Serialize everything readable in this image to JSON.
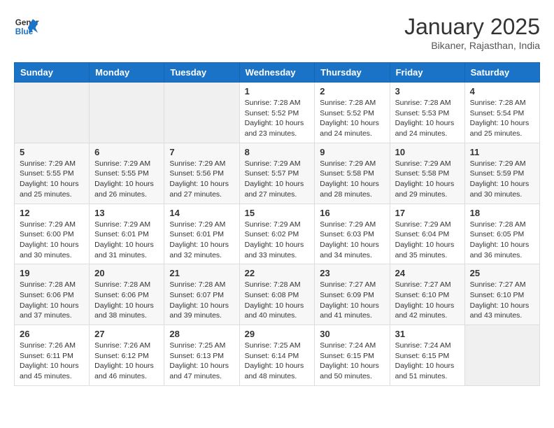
{
  "header": {
    "logo_general": "General",
    "logo_blue": "Blue",
    "month_title": "January 2025",
    "subtitle": "Bikaner, Rajasthan, India"
  },
  "weekdays": [
    "Sunday",
    "Monday",
    "Tuesday",
    "Wednesday",
    "Thursday",
    "Friday",
    "Saturday"
  ],
  "weeks": [
    [
      {
        "day": "",
        "info": ""
      },
      {
        "day": "",
        "info": ""
      },
      {
        "day": "",
        "info": ""
      },
      {
        "day": "1",
        "info": "Sunrise: 7:28 AM\nSunset: 5:52 PM\nDaylight: 10 hours\nand 23 minutes."
      },
      {
        "day": "2",
        "info": "Sunrise: 7:28 AM\nSunset: 5:52 PM\nDaylight: 10 hours\nand 24 minutes."
      },
      {
        "day": "3",
        "info": "Sunrise: 7:28 AM\nSunset: 5:53 PM\nDaylight: 10 hours\nand 24 minutes."
      },
      {
        "day": "4",
        "info": "Sunrise: 7:28 AM\nSunset: 5:54 PM\nDaylight: 10 hours\nand 25 minutes."
      }
    ],
    [
      {
        "day": "5",
        "info": "Sunrise: 7:29 AM\nSunset: 5:55 PM\nDaylight: 10 hours\nand 25 minutes."
      },
      {
        "day": "6",
        "info": "Sunrise: 7:29 AM\nSunset: 5:55 PM\nDaylight: 10 hours\nand 26 minutes."
      },
      {
        "day": "7",
        "info": "Sunrise: 7:29 AM\nSunset: 5:56 PM\nDaylight: 10 hours\nand 27 minutes."
      },
      {
        "day": "8",
        "info": "Sunrise: 7:29 AM\nSunset: 5:57 PM\nDaylight: 10 hours\nand 27 minutes."
      },
      {
        "day": "9",
        "info": "Sunrise: 7:29 AM\nSunset: 5:58 PM\nDaylight: 10 hours\nand 28 minutes."
      },
      {
        "day": "10",
        "info": "Sunrise: 7:29 AM\nSunset: 5:58 PM\nDaylight: 10 hours\nand 29 minutes."
      },
      {
        "day": "11",
        "info": "Sunrise: 7:29 AM\nSunset: 5:59 PM\nDaylight: 10 hours\nand 30 minutes."
      }
    ],
    [
      {
        "day": "12",
        "info": "Sunrise: 7:29 AM\nSunset: 6:00 PM\nDaylight: 10 hours\nand 30 minutes."
      },
      {
        "day": "13",
        "info": "Sunrise: 7:29 AM\nSunset: 6:01 PM\nDaylight: 10 hours\nand 31 minutes."
      },
      {
        "day": "14",
        "info": "Sunrise: 7:29 AM\nSunset: 6:01 PM\nDaylight: 10 hours\nand 32 minutes."
      },
      {
        "day": "15",
        "info": "Sunrise: 7:29 AM\nSunset: 6:02 PM\nDaylight: 10 hours\nand 33 minutes."
      },
      {
        "day": "16",
        "info": "Sunrise: 7:29 AM\nSunset: 6:03 PM\nDaylight: 10 hours\nand 34 minutes."
      },
      {
        "day": "17",
        "info": "Sunrise: 7:29 AM\nSunset: 6:04 PM\nDaylight: 10 hours\nand 35 minutes."
      },
      {
        "day": "18",
        "info": "Sunrise: 7:28 AM\nSunset: 6:05 PM\nDaylight: 10 hours\nand 36 minutes."
      }
    ],
    [
      {
        "day": "19",
        "info": "Sunrise: 7:28 AM\nSunset: 6:06 PM\nDaylight: 10 hours\nand 37 minutes."
      },
      {
        "day": "20",
        "info": "Sunrise: 7:28 AM\nSunset: 6:06 PM\nDaylight: 10 hours\nand 38 minutes."
      },
      {
        "day": "21",
        "info": "Sunrise: 7:28 AM\nSunset: 6:07 PM\nDaylight: 10 hours\nand 39 minutes."
      },
      {
        "day": "22",
        "info": "Sunrise: 7:28 AM\nSunset: 6:08 PM\nDaylight: 10 hours\nand 40 minutes."
      },
      {
        "day": "23",
        "info": "Sunrise: 7:27 AM\nSunset: 6:09 PM\nDaylight: 10 hours\nand 41 minutes."
      },
      {
        "day": "24",
        "info": "Sunrise: 7:27 AM\nSunset: 6:10 PM\nDaylight: 10 hours\nand 42 minutes."
      },
      {
        "day": "25",
        "info": "Sunrise: 7:27 AM\nSunset: 6:10 PM\nDaylight: 10 hours\nand 43 minutes."
      }
    ],
    [
      {
        "day": "26",
        "info": "Sunrise: 7:26 AM\nSunset: 6:11 PM\nDaylight: 10 hours\nand 45 minutes."
      },
      {
        "day": "27",
        "info": "Sunrise: 7:26 AM\nSunset: 6:12 PM\nDaylight: 10 hours\nand 46 minutes."
      },
      {
        "day": "28",
        "info": "Sunrise: 7:25 AM\nSunset: 6:13 PM\nDaylight: 10 hours\nand 47 minutes."
      },
      {
        "day": "29",
        "info": "Sunrise: 7:25 AM\nSunset: 6:14 PM\nDaylight: 10 hours\nand 48 minutes."
      },
      {
        "day": "30",
        "info": "Sunrise: 7:24 AM\nSunset: 6:15 PM\nDaylight: 10 hours\nand 50 minutes."
      },
      {
        "day": "31",
        "info": "Sunrise: 7:24 AM\nSunset: 6:15 PM\nDaylight: 10 hours\nand 51 minutes."
      },
      {
        "day": "",
        "info": ""
      }
    ]
  ]
}
